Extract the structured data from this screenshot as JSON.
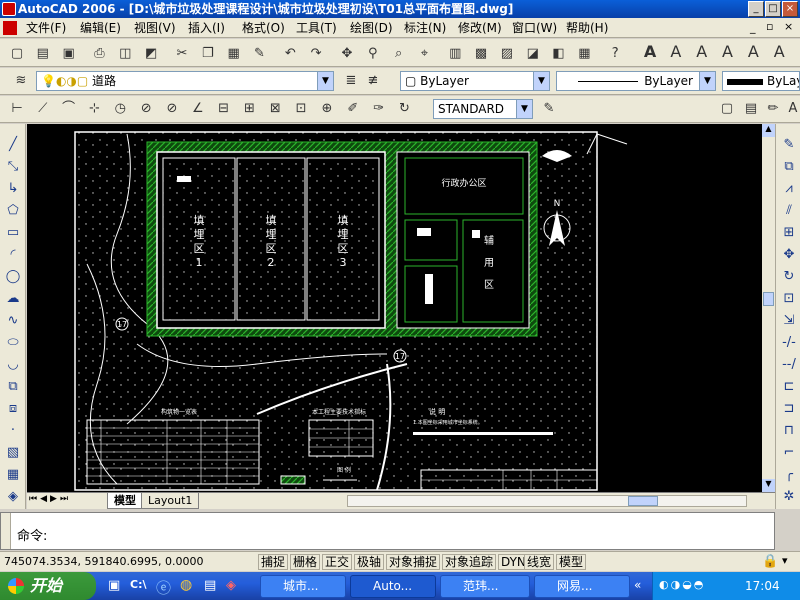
{
  "window": {
    "title": "AutoCAD 2006 - [D:\\城市垃圾处理课程设计\\城市垃圾处理初设\\T01总平面布置图.dwg]"
  },
  "menu": [
    "文件(F)",
    "编辑(E)",
    "视图(V)",
    "插入(I)",
    "格式(O)",
    "工具(T)",
    "绘图(D)",
    "标注(N)",
    "修改(M)",
    "窗口(W)",
    "帮助(H)"
  ],
  "layers": {
    "current": "道路"
  },
  "props": {
    "color": "ByLayer",
    "linetype": "ByLayer",
    "lineweight": "ByLay"
  },
  "textstyle": "STANDARD",
  "drawing": {
    "zones": [
      "填埋区\n1",
      "填埋区\n2",
      "填埋区\n3"
    ],
    "admin": "行政办公区",
    "aux": "辅\n用\n区",
    "table1_title": "构筑物一览表",
    "table2_title": "本工程主要技术指标",
    "notes_title": "说 明",
    "notes_line": "1.本图坐标采用城市坐标系统。",
    "legend_title": "图 例",
    "markers": [
      "⑰",
      "⑰"
    ],
    "north": "N"
  },
  "tabs": {
    "model": "模型",
    "layout1": "Layout1"
  },
  "command": {
    "prompt": "命令:"
  },
  "status": {
    "coords": "745074.3534, 591840.6995, 0.0000",
    "toggles": [
      "捕捉",
      "栅格",
      "正交",
      "极轴",
      "对象捕捉",
      "对象追踪",
      "DYN",
      "线宽",
      "模型"
    ]
  },
  "taskbar": {
    "start": "开始",
    "tasks": [
      "城市...",
      "Auto...",
      "范玮...",
      "网易..."
    ],
    "clock": "17:04"
  },
  "colors": {
    "titlebar": "#0a5fd8",
    "taskbar": "#245edb",
    "start": "#3c9a3c",
    "hatch": "#2bb52b"
  }
}
